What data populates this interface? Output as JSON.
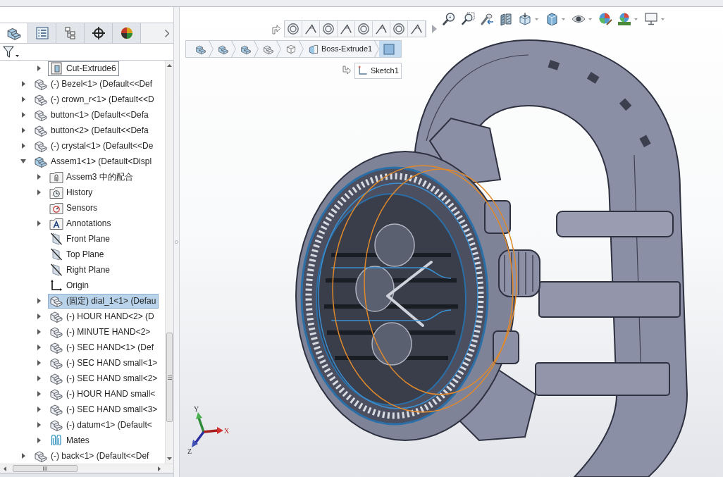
{
  "feature_manager": {
    "tabs": [
      {
        "kind": "features",
        "selected": true
      },
      {
        "kind": "properties",
        "selected": false
      },
      {
        "kind": "configurations",
        "selected": false
      },
      {
        "kind": "dimxpert",
        "selected": false
      },
      {
        "kind": "display",
        "selected": false
      }
    ],
    "tree": [
      {
        "children": [
          {
            "label": "Cut-Extrude6",
            "kind": "cut",
            "expandable": true,
            "expanded": false,
            "selected": false,
            "hovered": true
          }
        ]
      },
      {
        "label": "(-) Bezel<1> (Default<<Def",
        "kind": "part",
        "expandable": true,
        "expanded": false,
        "selected": false,
        "hovered": false
      },
      {
        "label": "(-) crown_r<1> (Default<<D",
        "kind": "part",
        "expandable": true,
        "expanded": false,
        "selected": false,
        "hovered": false
      },
      {
        "label": "button<1> (Default<<Defa",
        "kind": "part",
        "expandable": true,
        "expanded": false,
        "selected": false,
        "hovered": false
      },
      {
        "label": "button<2> (Default<<Defa",
        "kind": "part",
        "expandable": true,
        "expanded": false,
        "selected": false,
        "hovered": false
      },
      {
        "label": "(-) crystal<1> (Default<<De",
        "kind": "part",
        "expandable": true,
        "expanded": false,
        "selected": false,
        "hovered": false
      },
      {
        "label": "Assem1<1> (Default<Displ",
        "kind": "assembly",
        "expandable": true,
        "expanded": true,
        "selected": false,
        "hovered": false,
        "children": [
          {
            "label": "Assem3 中的配合",
            "kind": "mates-folder",
            "expandable": true,
            "expanded": false,
            "selected": false,
            "hovered": false
          },
          {
            "label": "History",
            "kind": "history-folder",
            "expandable": true,
            "expanded": false,
            "selected": false,
            "hovered": false
          },
          {
            "label": "Sensors",
            "kind": "sensors-folder",
            "expandable": false,
            "selected": false,
            "hovered": false
          },
          {
            "label": "Annotations",
            "kind": "annotations-folder",
            "expandable": true,
            "expanded": false,
            "selected": false,
            "hovered": false
          },
          {
            "label": "Front Plane",
            "kind": "plane",
            "expandable": false,
            "selected": false,
            "hovered": false
          },
          {
            "label": "Top Plane",
            "kind": "plane",
            "expandable": false,
            "selected": false,
            "hovered": false
          },
          {
            "label": "Right Plane",
            "kind": "plane",
            "expandable": false,
            "selected": false,
            "hovered": false
          },
          {
            "label": "Origin",
            "kind": "origin",
            "expandable": false,
            "selected": false,
            "hovered": false
          },
          {
            "label": "(固定) dial_1<1> (Defau",
            "kind": "part",
            "expandable": true,
            "expanded": false,
            "selected": true,
            "hovered": false
          },
          {
            "label": "(-) HOUR HAND<2> (D",
            "kind": "part",
            "expandable": true,
            "expanded": false,
            "selected": false,
            "hovered": false
          },
          {
            "label": "(-) MINUTE HAND<2>",
            "kind": "part",
            "expandable": true,
            "expanded": false,
            "selected": false,
            "hovered": false
          },
          {
            "label": "(-) SEC HAND<1> (Def",
            "kind": "part",
            "expandable": true,
            "expanded": false,
            "selected": false,
            "hovered": false
          },
          {
            "label": "(-) SEC HAND small<1>",
            "kind": "part",
            "expandable": true,
            "expanded": false,
            "selected": false,
            "hovered": false
          },
          {
            "label": "(-) SEC HAND small<2>",
            "kind": "part",
            "expandable": true,
            "expanded": false,
            "selected": false,
            "hovered": false
          },
          {
            "label": "(-) HOUR HAND small<",
            "kind": "part",
            "expandable": true,
            "expanded": false,
            "selected": false,
            "hovered": false
          },
          {
            "label": "(-) SEC HAND small<3>",
            "kind": "part",
            "expandable": true,
            "expanded": false,
            "selected": false,
            "hovered": false
          },
          {
            "label": "(-) datum<1> (Default<",
            "kind": "part",
            "expandable": true,
            "expanded": false,
            "selected": false,
            "hovered": false
          },
          {
            "label": "Mates",
            "kind": "mates",
            "expandable": true,
            "expanded": false,
            "selected": false,
            "hovered": false
          }
        ]
      },
      {
        "label": "(-) back<1> (Default<<Def",
        "kind": "part",
        "expandable": true,
        "expanded": false,
        "selected": false,
        "hovered": false
      }
    ]
  },
  "viewport": {
    "breadcrumbs": [
      {
        "kind": "assembly",
        "selected": false
      },
      {
        "kind": "assembly",
        "selected": false
      },
      {
        "kind": "assembly",
        "selected": false
      },
      {
        "kind": "part",
        "selected": false
      },
      {
        "kind": "body",
        "selected": false
      },
      {
        "kind": "feature",
        "label": "Boss-Extrude1",
        "selected": false
      },
      {
        "kind": "face",
        "selected": true
      }
    ],
    "sketch_crumb": {
      "label": "Sketch1"
    },
    "triad": {
      "x": "X",
      "y": "Y",
      "z": "Z"
    }
  }
}
